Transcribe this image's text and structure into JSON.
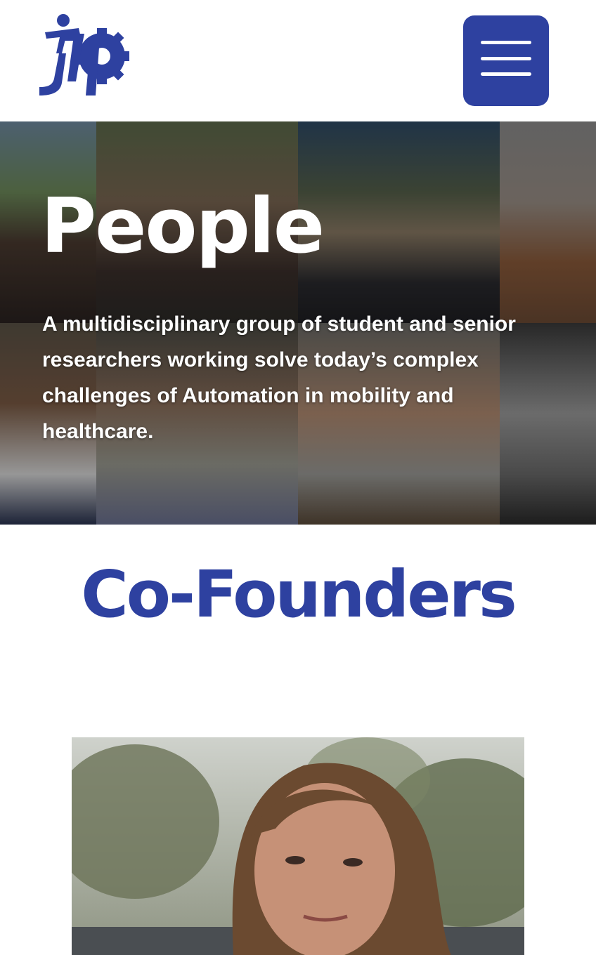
{
  "header": {
    "logo_name": "iap-logo",
    "menu_icon": "hamburger-menu-icon"
  },
  "hero": {
    "title": "People",
    "description": "A multidisciplinary group of student and senior researchers working solve today’s complex challenges of Automation in mobility and healthcare."
  },
  "cofounders": {
    "title": "Co-Founders"
  },
  "colors": {
    "brand_blue": "#2e41a0",
    "white": "#ffffff"
  }
}
